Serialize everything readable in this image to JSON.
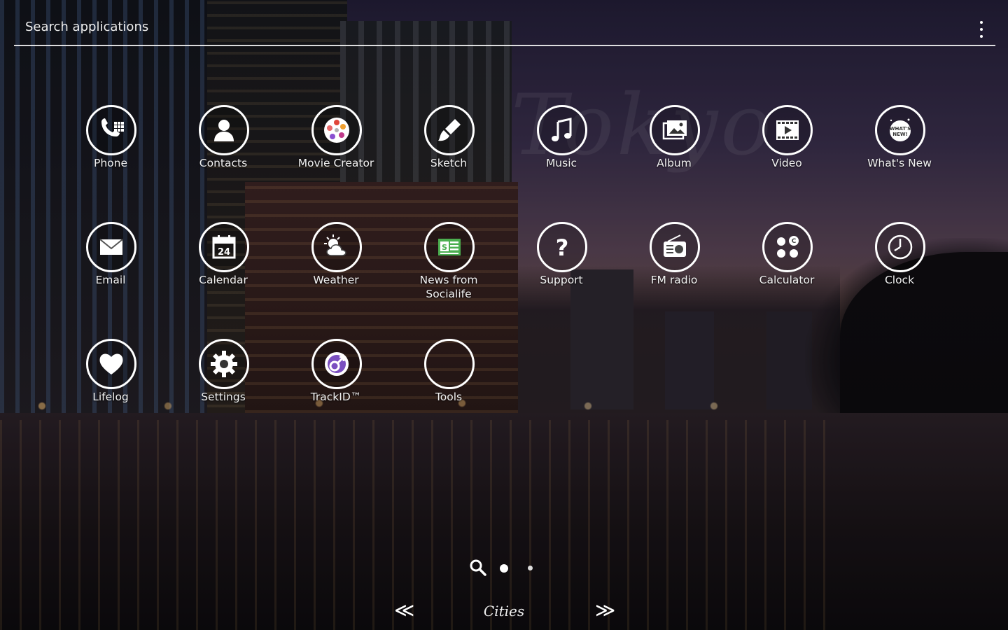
{
  "search": {
    "label": "Search applications"
  },
  "apps": [
    {
      "label": "Phone",
      "icon": "phone-icon"
    },
    {
      "label": "Contacts",
      "icon": "contacts-icon"
    },
    {
      "label": "Movie Creator",
      "icon": "movie-creator-icon"
    },
    {
      "label": "Sketch",
      "icon": "sketch-icon"
    },
    {
      "label": "Music",
      "icon": "music-icon"
    },
    {
      "label": "Album",
      "icon": "album-icon"
    },
    {
      "label": "Video",
      "icon": "video-icon"
    },
    {
      "label": "What's New",
      "icon": "whats-new-icon",
      "badge": "WHAT'S NEW"
    },
    {
      "label": "Email",
      "icon": "email-icon"
    },
    {
      "label": "Calendar",
      "icon": "calendar-icon",
      "day": "24"
    },
    {
      "label": "Weather",
      "icon": "weather-icon"
    },
    {
      "label": "News from Socialife",
      "icon": "news-icon",
      "glyph": "S"
    },
    {
      "label": "Support",
      "icon": "support-icon"
    },
    {
      "label": "FM radio",
      "icon": "fm-radio-icon"
    },
    {
      "label": "Calculator",
      "icon": "calculator-icon"
    },
    {
      "label": "Clock",
      "icon": "clock-icon"
    },
    {
      "label": "Lifelog",
      "icon": "lifelog-icon"
    },
    {
      "label": "Settings",
      "icon": "settings-icon"
    },
    {
      "label": "TrackID™",
      "icon": "trackid-icon"
    },
    {
      "label": "Tools",
      "icon": "tools-folder-icon"
    }
  ],
  "pager": {
    "pages": 2,
    "active_page": 1
  },
  "theme": {
    "name": "Cities",
    "prev": "≪",
    "next": "≫"
  },
  "colors": {
    "icon_ring": "#ffffff",
    "movie_creator_accent": "#e0463a",
    "trackid_accent": "#7a4fc0",
    "news_accent": "#4caf50"
  }
}
